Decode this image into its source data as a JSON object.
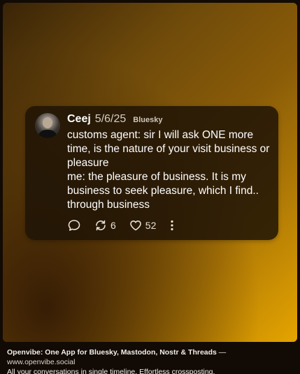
{
  "post": {
    "author": "Ceej",
    "date": "5/6/25",
    "network": "Bluesky",
    "text": "customs agent: sir I will ask ONE more time, is the nature of your visit business or pleasure\nme: the pleasure of business. It is my business to seek pleasure, which I find.. through business",
    "reposts": "6",
    "likes": "52"
  },
  "footer": {
    "tagline": "Openvibe: One App for Bluesky, Mastodon, Nostr & Threads",
    "separator": " — ",
    "url": "www.openvibe.social",
    "subline": "All your conversations in single timeline. Effortless crossposting."
  },
  "icons": {
    "reply": "reply-bubble-icon",
    "repost": "repost-arrows-icon",
    "like": "heart-icon",
    "more": "more-vertical-icon"
  },
  "colors": {
    "gradient_start": "#3a2408",
    "gradient_end": "#e5a400",
    "card_bg": "#20140e"
  }
}
